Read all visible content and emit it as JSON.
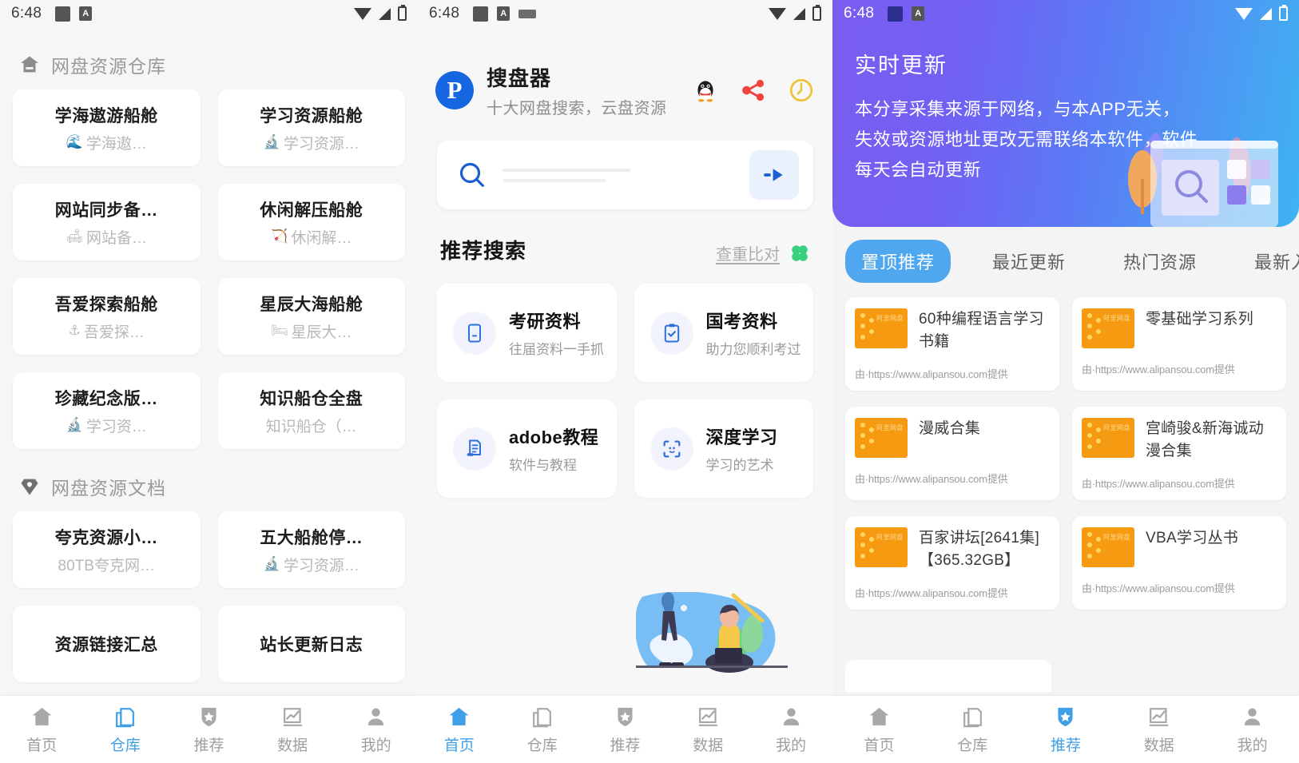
{
  "statusbar": {
    "time": "6:48"
  },
  "panel1": {
    "sections": [
      {
        "icon": "home-icon",
        "title": "网盘资源仓库",
        "cards": [
          {
            "title": "学海遨游船舱",
            "emoji": "🌊",
            "sub": "学海遨…"
          },
          {
            "title": "学习资源船舱",
            "emoji": "🔬",
            "sub": "学习资源…"
          },
          {
            "title": "网站同步备…",
            "emoji": "🛋",
            "sub": "网站备…"
          },
          {
            "title": "休闲解压船舱",
            "emoji": "🏹",
            "sub": "休闲解…"
          },
          {
            "title": "吾爱探索船舱",
            "emoji": "⚓",
            "sub": "吾爱探…"
          },
          {
            "title": "星辰大海船舱",
            "emoji": "🛏",
            "sub": "星辰大…"
          },
          {
            "title": "珍藏纪念版…",
            "emoji": "🔬",
            "sub": "学习资…"
          },
          {
            "title": "知识船仓全盘",
            "emoji": "",
            "sub": "知识船仓（…"
          }
        ]
      },
      {
        "icon": "gem-icon",
        "title": "网盘资源文档",
        "cards": [
          {
            "title": "夸克资源小…",
            "emoji": "",
            "sub": "80TB夸克网…"
          },
          {
            "title": "五大船舱停…",
            "emoji": "🔬",
            "sub": "学习资源…"
          },
          {
            "title": "资源链接汇总",
            "emoji": "",
            "sub": ""
          },
          {
            "title": "站长更新日志",
            "emoji": "",
            "sub": ""
          }
        ]
      }
    ],
    "tabbar": {
      "active_index": 1,
      "items": [
        {
          "label": "首页",
          "icon": "home-icon"
        },
        {
          "label": "仓库",
          "icon": "warehouse-icon"
        },
        {
          "label": "推荐",
          "icon": "badge-star-icon"
        },
        {
          "label": "数据",
          "icon": "chart-icon"
        },
        {
          "label": "我的",
          "icon": "person-icon"
        }
      ]
    }
  },
  "panel2": {
    "header": {
      "logo_letter": "P",
      "app_name": "搜盘器",
      "slogan": "十大网盘搜索，云盘资源",
      "icons": [
        {
          "name": "qq-penguin-icon"
        },
        {
          "name": "share-icon"
        },
        {
          "name": "clock-icon"
        }
      ]
    },
    "search": {
      "placeholder": "",
      "value": "",
      "search_icon": "search-icon",
      "go_icon": "arrow-right-icon"
    },
    "recommend": {
      "title": "推荐搜索",
      "link": "查重比对",
      "link_icon": "clover-icon",
      "cards": [
        {
          "title": "考研资料",
          "sub": "往届资料一手抓",
          "icon": "document-icon"
        },
        {
          "title": "国考资料",
          "sub": "助力您顺利考过",
          "icon": "clipboard-check-icon"
        },
        {
          "title": "adobe教程",
          "sub": "软件与教程",
          "icon": "file-lines-icon"
        },
        {
          "title": "深度学习",
          "sub": "学习的艺术",
          "icon": "face-scan-icon"
        }
      ]
    },
    "illustration": "person-with-laptop-illustration",
    "tabbar": {
      "active_index": 0,
      "items": [
        {
          "label": "首页",
          "icon": "home-icon"
        },
        {
          "label": "仓库",
          "icon": "warehouse-icon"
        },
        {
          "label": "推荐",
          "icon": "badge-star-icon"
        },
        {
          "label": "数据",
          "icon": "chart-icon"
        },
        {
          "label": "我的",
          "icon": "person-icon"
        }
      ]
    }
  },
  "panel3": {
    "banner": {
      "title": "实时更新",
      "text": "本分享采集来源于网络，与本APP无关，失效或资源地址更改无需联络本软件，软件每天会自动更新",
      "art": "search-window-illustration",
      "gradient_from": "#7b5cf0",
      "gradient_to": "#3fb3f2"
    },
    "tabs": {
      "active_index": 0,
      "items": [
        {
          "label": "置顶推荐"
        },
        {
          "label": "最近更新"
        },
        {
          "label": "热门资源"
        },
        {
          "label": "最新入库"
        }
      ]
    },
    "resource_source": "由·https://www.alipansou.com提供",
    "thumb_watermark": "阿里网盘",
    "resources": [
      {
        "title": "60种编程语言学习书籍",
        "source": "由·https://www.alipansou.com提供"
      },
      {
        "title": "零基础学习系列",
        "source": "由·https://www.alipansou.com提供"
      },
      {
        "title": "漫威合集",
        "source": "由·https://www.alipansou.com提供"
      },
      {
        "title": "宫崎骏&新海诚动漫合集",
        "source": "由·https://www.alipansou.com提供"
      },
      {
        "title": "百家讲坛[2641集]【365.32GB】",
        "source": "由·https://www.alipansou.com提供"
      },
      {
        "title": "VBA学习丛书",
        "source": "由·https://www.alipansou.com提供"
      }
    ],
    "tabbar": {
      "active_index": 2,
      "items": [
        {
          "label": "首页",
          "icon": "home-icon"
        },
        {
          "label": "仓库",
          "icon": "warehouse-icon"
        },
        {
          "label": "推荐",
          "icon": "badge-star-icon"
        },
        {
          "label": "数据",
          "icon": "chart-icon"
        },
        {
          "label": "我的",
          "icon": "person-icon"
        }
      ]
    }
  }
}
